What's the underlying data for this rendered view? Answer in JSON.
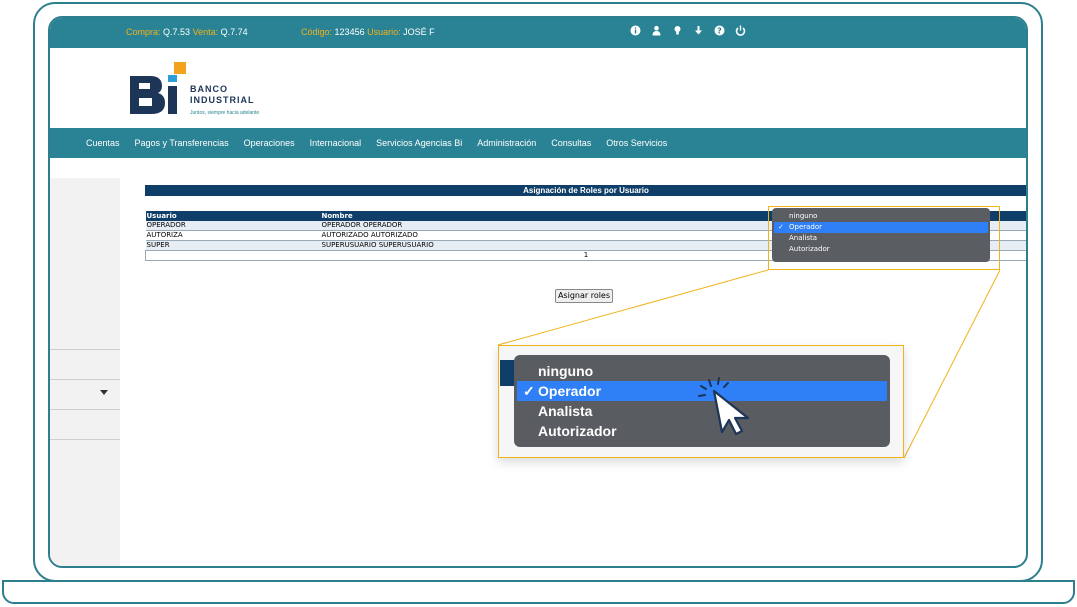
{
  "topbar": {
    "compra_label": "Compra:",
    "compra_value": "Q.7.53",
    "venta_label": "Venta:",
    "venta_value": "Q.7.74",
    "codigo_label": "Código:",
    "codigo_value": "123456",
    "usuario_label": "Usuario:",
    "usuario_value": "JOSÉ F",
    "icons": [
      "info-icon",
      "user-icon",
      "lightbulb-icon",
      "download-icon",
      "help-icon",
      "power-icon"
    ]
  },
  "logo": {
    "bank_line1": "BANCO",
    "bank_line2": "INDUSTRIAL",
    "tagline": "Juntos, siempre hacia adelante"
  },
  "nav": [
    "Cuentas",
    "Pagos y Transferencias",
    "Operaciones",
    "Internacional",
    "Servicios Agencias Bi",
    "Administración",
    "Consultas",
    "Otros Servicios"
  ],
  "panel": {
    "title": "Asignación de Roles por Usuario",
    "columns": [
      "Usuario",
      "Nombre"
    ],
    "rows": [
      {
        "usuario": "OPERADOR",
        "nombre": "OPERADOR OPERADOR"
      },
      {
        "usuario": "AUTORIZA",
        "nombre": "AUTORIZADO AUTORIZADO"
      },
      {
        "usuario": "SUPER",
        "nombre": "SUPERUSUARIO SUPERUSUARIO"
      }
    ],
    "page": "1",
    "assign_button": "Asignar roles"
  },
  "dropdown": {
    "options": [
      "ninguno",
      "Operador",
      "Analista",
      "Autorizador"
    ],
    "selected": "Operador",
    "check": "✓"
  },
  "colors": {
    "teal": "#2a8394",
    "navy": "#0f3f68",
    "gold": "#f2b21c",
    "select_blue": "#2f7ff6"
  }
}
